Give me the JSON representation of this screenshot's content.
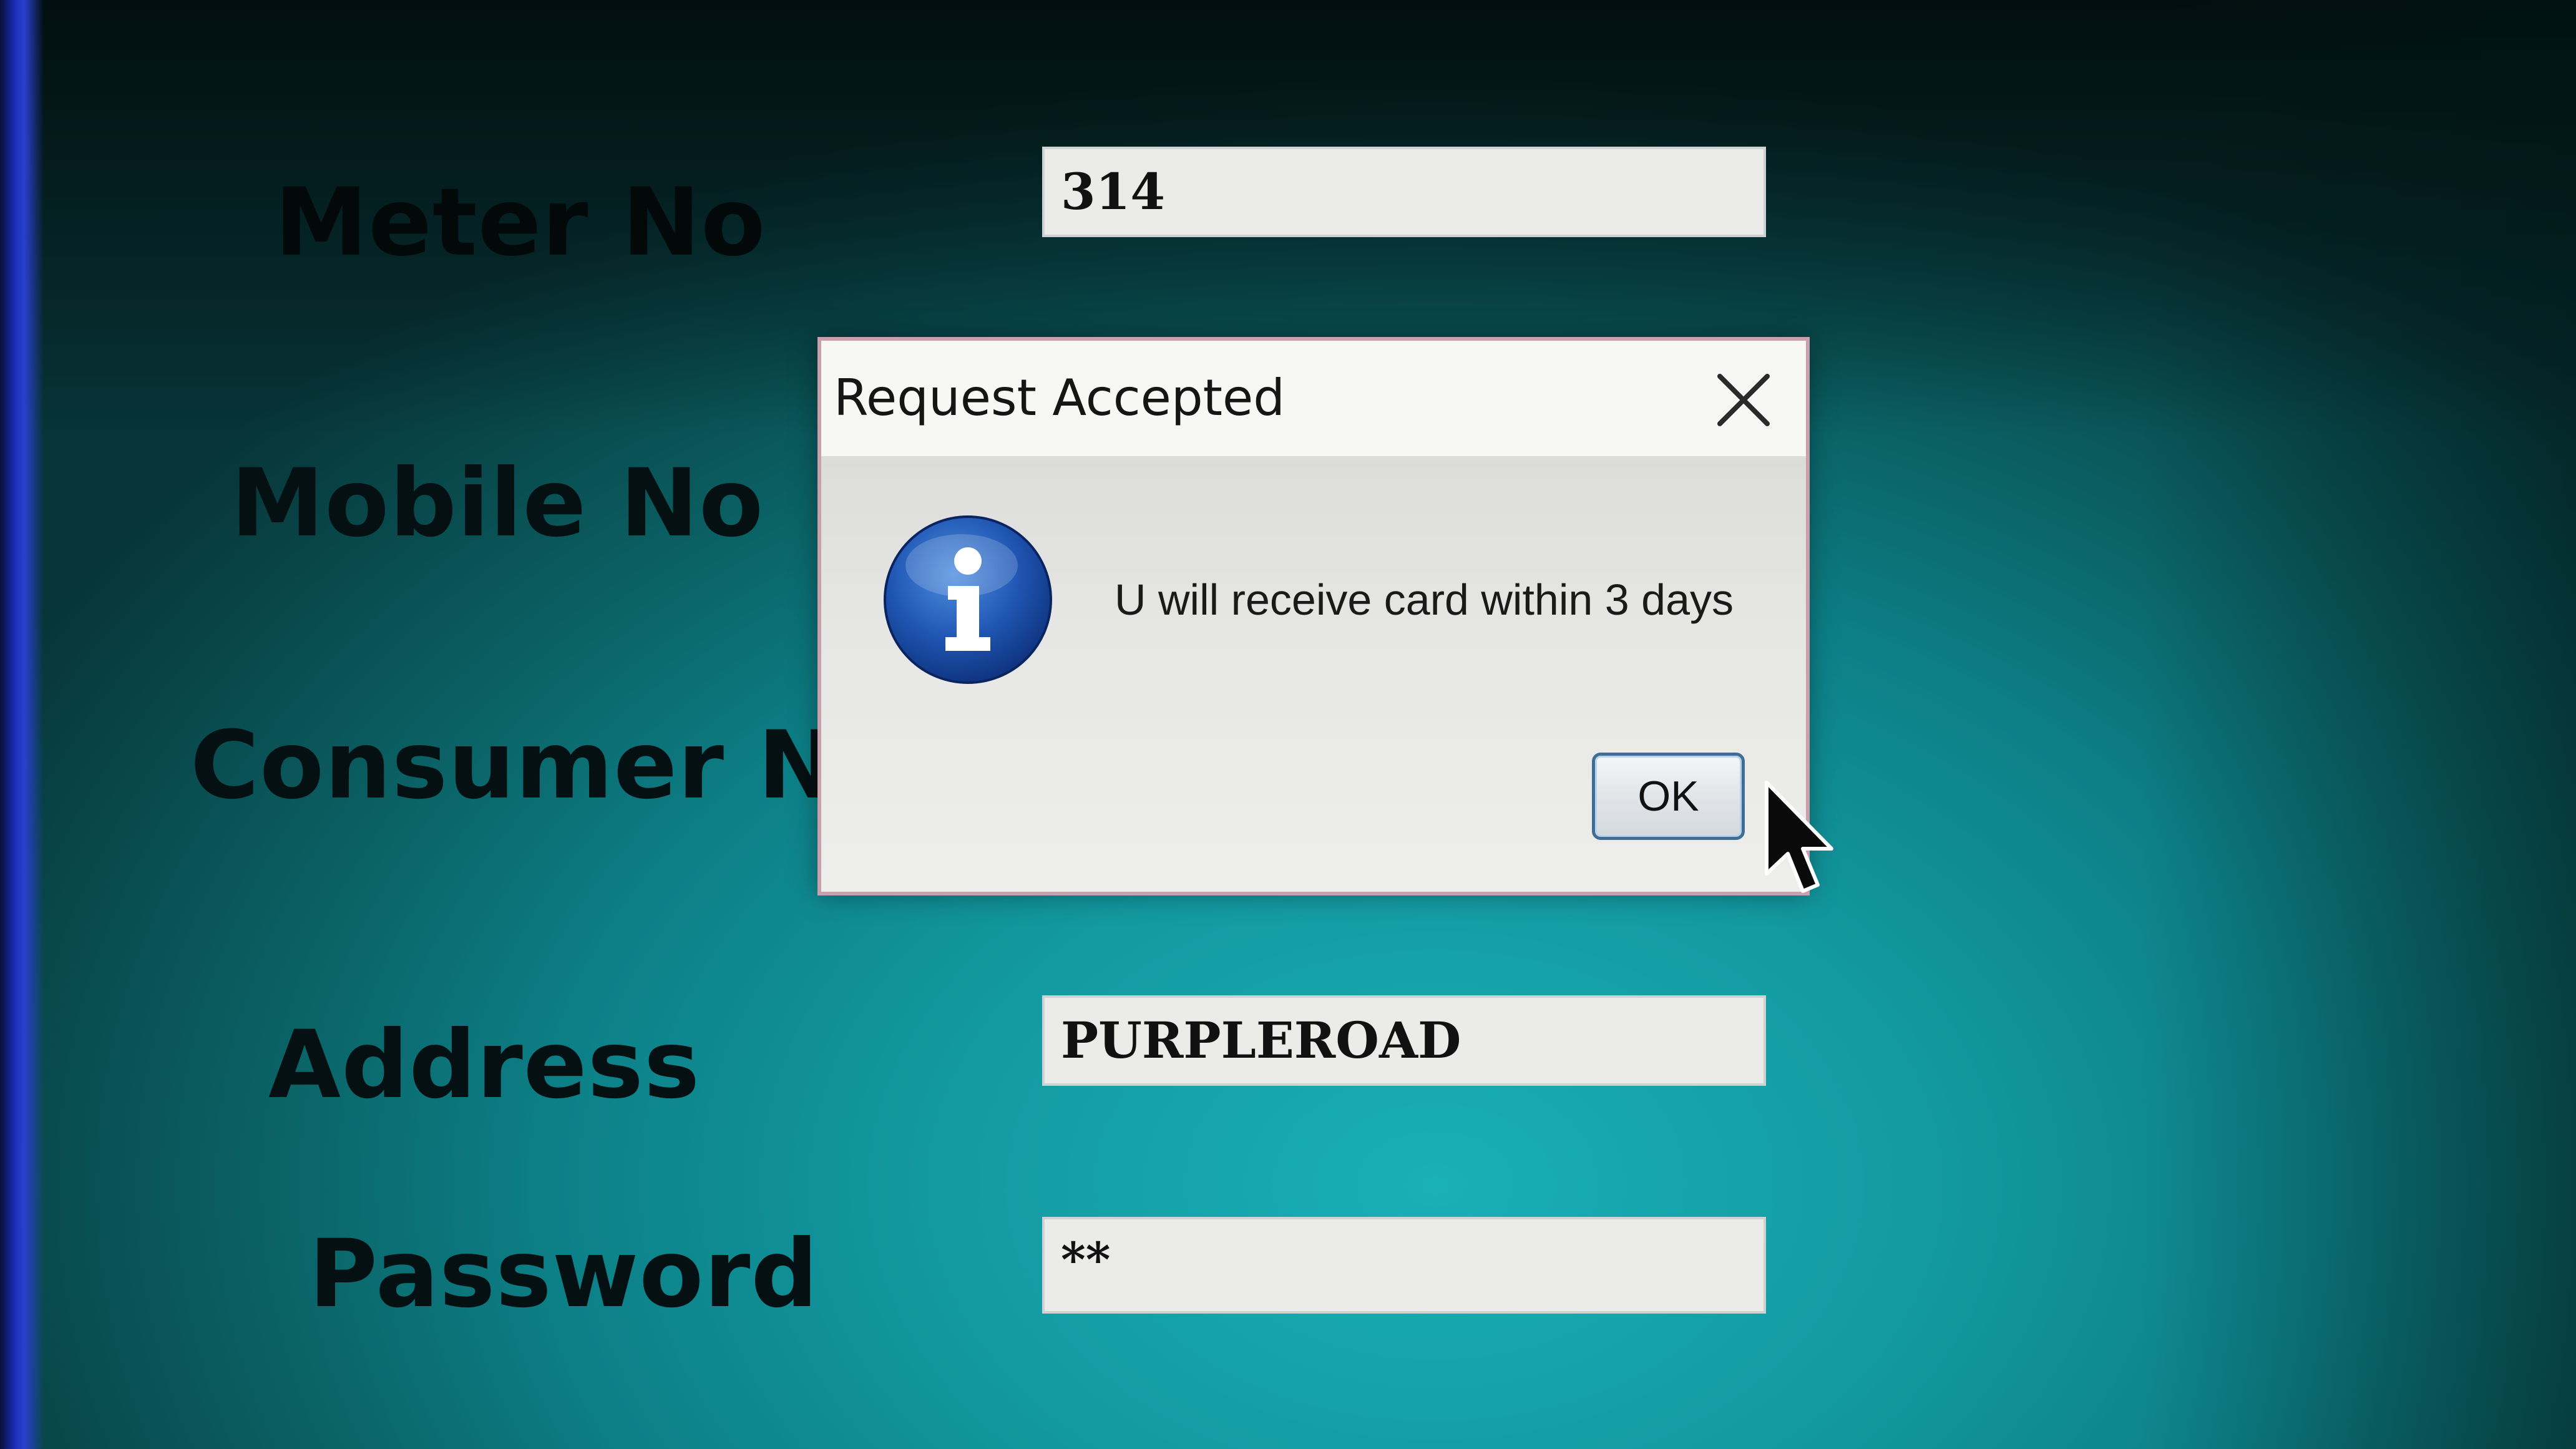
{
  "form": {
    "meter_no_label": "Meter No",
    "meter_no_value": "314",
    "mobile_no_label": "Mobile No",
    "consumer_no_label": "Consumer No",
    "address_label": "Address",
    "address_value": "PURPLEROAD",
    "password_label": "Password",
    "password_value": "**"
  },
  "dialog": {
    "title": "Request Accepted",
    "close_icon": "close-icon",
    "icon": "info-icon",
    "message": "U will receive card within 3 days",
    "ok_label": "OK"
  },
  "colors": {
    "background_teal": "#139aa1",
    "dialog_border": "#c9a0ad",
    "info_icon_blue": "#1a4ea8",
    "ok_button_border": "#3f6d95"
  }
}
